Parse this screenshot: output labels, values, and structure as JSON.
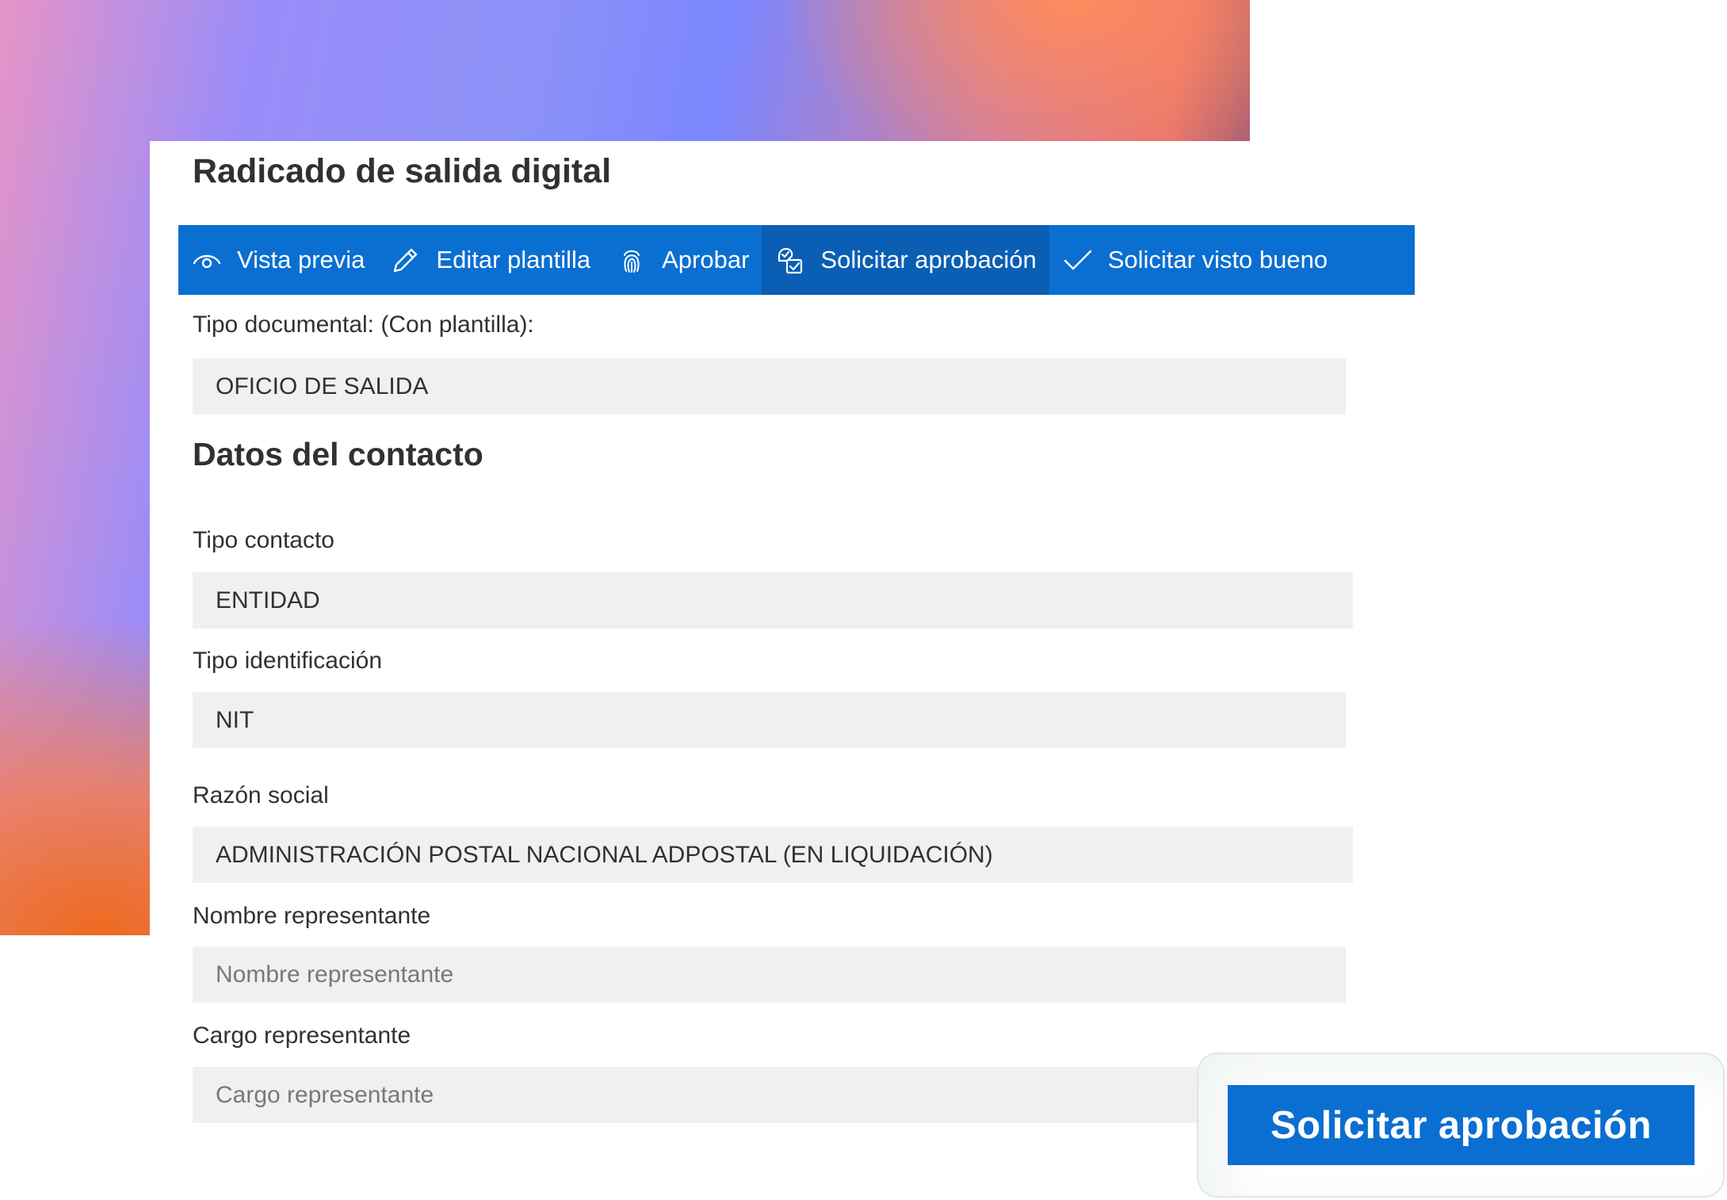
{
  "page": {
    "title": "Radicado de salida digital"
  },
  "toolbar": {
    "items": [
      {
        "label": "Vista previa",
        "icon": "eye-icon"
      },
      {
        "label": "Editar plantilla",
        "icon": "pencil-icon"
      },
      {
        "label": "Aprobar",
        "icon": "fingerprint-icon"
      },
      {
        "label": "Solicitar aprobación",
        "icon": "request-approval-icon",
        "active": true
      },
      {
        "label": "Solicitar visto bueno",
        "icon": "checkmark-icon"
      }
    ]
  },
  "form": {
    "document_type": {
      "label": "Tipo documental: (Con plantilla):",
      "value": "OFICIO DE SALIDA"
    },
    "contact_section_title": "Datos del contacto",
    "contact_type": {
      "label": "Tipo contacto",
      "value": "ENTIDAD"
    },
    "id_type": {
      "label": "Tipo identificación",
      "value": "NIT"
    },
    "business_name": {
      "label": "Razón social",
      "value": "ADMINISTRACIÓN POSTAL NACIONAL ADPOSTAL (EN LIQUIDACIÓN)"
    },
    "representative_name": {
      "label": "Nombre representante",
      "placeholder": "Nombre representante"
    },
    "representative_role": {
      "label": "Cargo representante",
      "placeholder": "Cargo representante"
    }
  },
  "callout": {
    "button_label": "Solicitar aprobación"
  },
  "colors": {
    "accent": "#0a6fd1",
    "accent_active": "#0a5fb4",
    "field_bg": "#f2f0ef",
    "text": "#323130"
  }
}
